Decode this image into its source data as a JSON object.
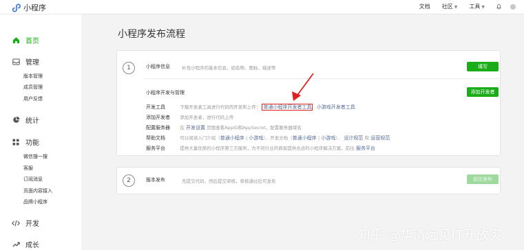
{
  "app": {
    "name": "小程序"
  },
  "topnav": {
    "docs": "文档",
    "community": "社区",
    "tools": "工具"
  },
  "sidebar": {
    "home": "首页",
    "manage": "管理",
    "manage_items": [
      "版本管理",
      "成员管理",
      "用户反馈"
    ],
    "stats": "统计",
    "features": "功能",
    "feature_items": [
      "微信搜一搜",
      "客服",
      "订阅消息",
      "页面内容接入",
      "品牌小程序"
    ],
    "dev": "开发",
    "grow": "成长"
  },
  "page": {
    "title": "小程序发布流程"
  },
  "step1": {
    "number": "1",
    "info_label": "小程序信息",
    "info_desc": "补充小程序的基本信息，如名称、图标、描述等",
    "fill_button": "填写",
    "dev_manage_label": "小程序开发与管理",
    "add_dev_button": "添加开发者",
    "rows": {
      "tools_key": "开发工具",
      "tools_desc": "下载开发者工具进行代码的开发和上传：",
      "tools_link1": "普通小程序开发者工具",
      "tools_link2": "小游戏开发者工具",
      "adddev_key": "添加开发者",
      "adddev_desc": "添加开发者，进行代码上传",
      "server_key": "配置服务器",
      "server_desc_pre": "在",
      "server_link": "开发设置",
      "server_desc_post": "页面查看AppID和AppSecret，配置服务器域名",
      "help_key": "帮助文档",
      "help_desc1": "可以阅读入门介绍（",
      "help_link1": "普通小程序",
      "help_sep1": "|",
      "help_link2": "小游戏",
      "help_desc2": "）、开发文档（",
      "help_link3": "普通小程序",
      "help_sep2": "|",
      "help_link4": "小游戏",
      "help_desc3": "）、",
      "help_link5": "设计规范",
      "help_and": "和",
      "help_link6": "运营规范",
      "service_key": "服务平台",
      "service_desc": "提供大量优质的小程序第三方服务，为不同行业的商家提供合适的小程序解决方案。前往",
      "service_link": "服务平台"
    }
  },
  "step2": {
    "number": "2",
    "label": "版本发布",
    "desc": "先提交代码，然后提交审核，审核通过后可发布",
    "button": "前往发布"
  },
  "watermark": "知乎 @华清远见IT开放实...",
  "colors": {
    "accent": "#1aad19",
    "link": "#576b95",
    "highlight": "#e02020"
  }
}
